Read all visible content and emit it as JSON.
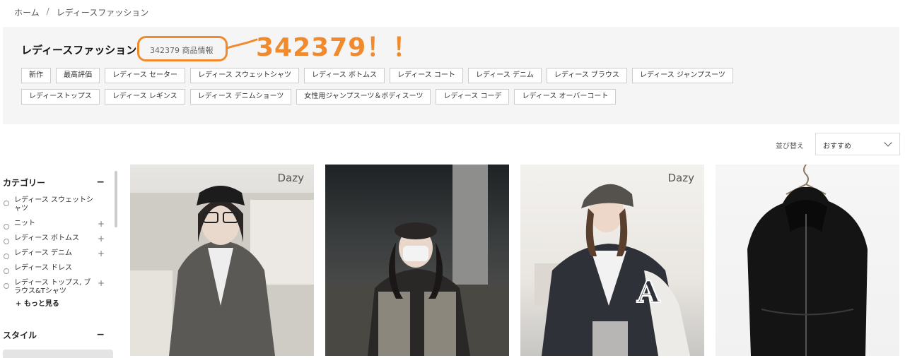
{
  "breadcrumb": {
    "home": "ホーム",
    "separator": "/",
    "current": "レディースファッション"
  },
  "header": {
    "title": "レディースファッション",
    "count": "342379 商品情報",
    "annotation": "342379！！",
    "annotation_color": "#f08a2c"
  },
  "tags": [
    "新作",
    "最高評価",
    "レディース セーター",
    "レディース スウェットシャツ",
    "レディース ボトムス",
    "レディース コート",
    "レディース デニム",
    "レディース ブラウス",
    "レディース ジャンプスーツ",
    "レディーストップス",
    "レディース レギンス",
    "レディース デニムショーツ",
    "女性用ジャンプスーツ＆ボディスーツ",
    "レディース コーデ",
    "レディース オーバーコート"
  ],
  "sort": {
    "label": "並び替え",
    "selected": "おすすめ"
  },
  "sidebar": {
    "category_title": "カテゴリー",
    "categories": [
      {
        "label": "レディース スウェットシャツ",
        "expandable": false
      },
      {
        "label": "ニット",
        "expandable": true
      },
      {
        "label": "レディース ボトムス",
        "expandable": true
      },
      {
        "label": "レディース デニム",
        "expandable": true
      },
      {
        "label": "レディース ドレス",
        "expandable": false
      },
      {
        "label": "レディース トップス, ブラウス&Tシャツ",
        "expandable": true
      }
    ],
    "more": "+ もっと見る",
    "style_title": "スタイル",
    "collapse_symbol": "−"
  },
  "products": [
    {
      "brand": "Dazy",
      "icon": "gray-cardigan-photo"
    },
    {
      "brand": "",
      "icon": "tweed-jacket-photo"
    },
    {
      "brand": "Dazy",
      "icon": "varsity-jacket-photo"
    },
    {
      "brand": "",
      "icon": "black-hooded-jacket-photo"
    }
  ]
}
